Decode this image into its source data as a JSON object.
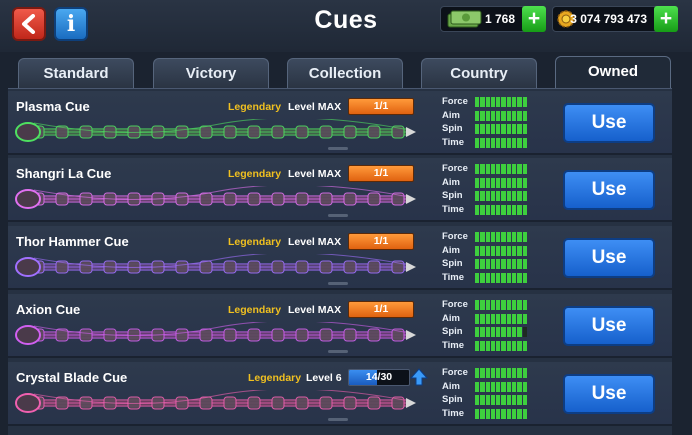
{
  "header": {
    "title": "Cues",
    "back_icon": "back-arrow-icon",
    "info_label": "i",
    "cash": "1 768",
    "coins": "3 074 793 473",
    "plus": "+"
  },
  "tabs": [
    {
      "label": "Standard",
      "active": false
    },
    {
      "label": "Victory",
      "active": false
    },
    {
      "label": "Collection",
      "active": false
    },
    {
      "label": "Country",
      "active": false
    },
    {
      "label": "Owned",
      "active": true
    }
  ],
  "stat_labels": [
    "Force",
    "Aim",
    "Spin",
    "Time"
  ],
  "cues": [
    {
      "name": "Plasma Cue",
      "rarity": "Legendary",
      "level": "Level MAX",
      "progress": "1/1",
      "force": 10,
      "aim": 10,
      "spin": 10,
      "time": 10,
      "use": "Use",
      "accent": "#4ee060"
    },
    {
      "name": "Shangri La Cue",
      "rarity": "Legendary",
      "level": "Level MAX",
      "progress": "1/1",
      "force": 10,
      "aim": 10,
      "spin": 10,
      "time": 10,
      "use": "Use",
      "accent": "#e070f0"
    },
    {
      "name": "Thor Hammer Cue",
      "rarity": "Legendary",
      "level": "Level MAX",
      "progress": "1/1",
      "force": 10,
      "aim": 10,
      "spin": 10,
      "time": 10,
      "use": "Use",
      "accent": "#a070ff"
    },
    {
      "name": "Axion Cue",
      "rarity": "Legendary",
      "level": "Level MAX",
      "progress": "1/1",
      "force": 10,
      "aim": 10,
      "spin": 9,
      "time": 10,
      "use": "Use",
      "accent": "#d060f0"
    },
    {
      "name": "Crystal Blade Cue",
      "rarity": "Legendary",
      "level": "Level 6",
      "progress": "14/30",
      "progress_fraction": 0.467,
      "force": 10,
      "aim": 10,
      "spin": 10,
      "time": 10,
      "use": "Use",
      "accent": "#f060b0"
    }
  ],
  "colors": {
    "legendary": "#f0c020",
    "stat_on": "#3ecf3e",
    "use_button": "#2a78e4",
    "level_bar": "#f07a20"
  }
}
